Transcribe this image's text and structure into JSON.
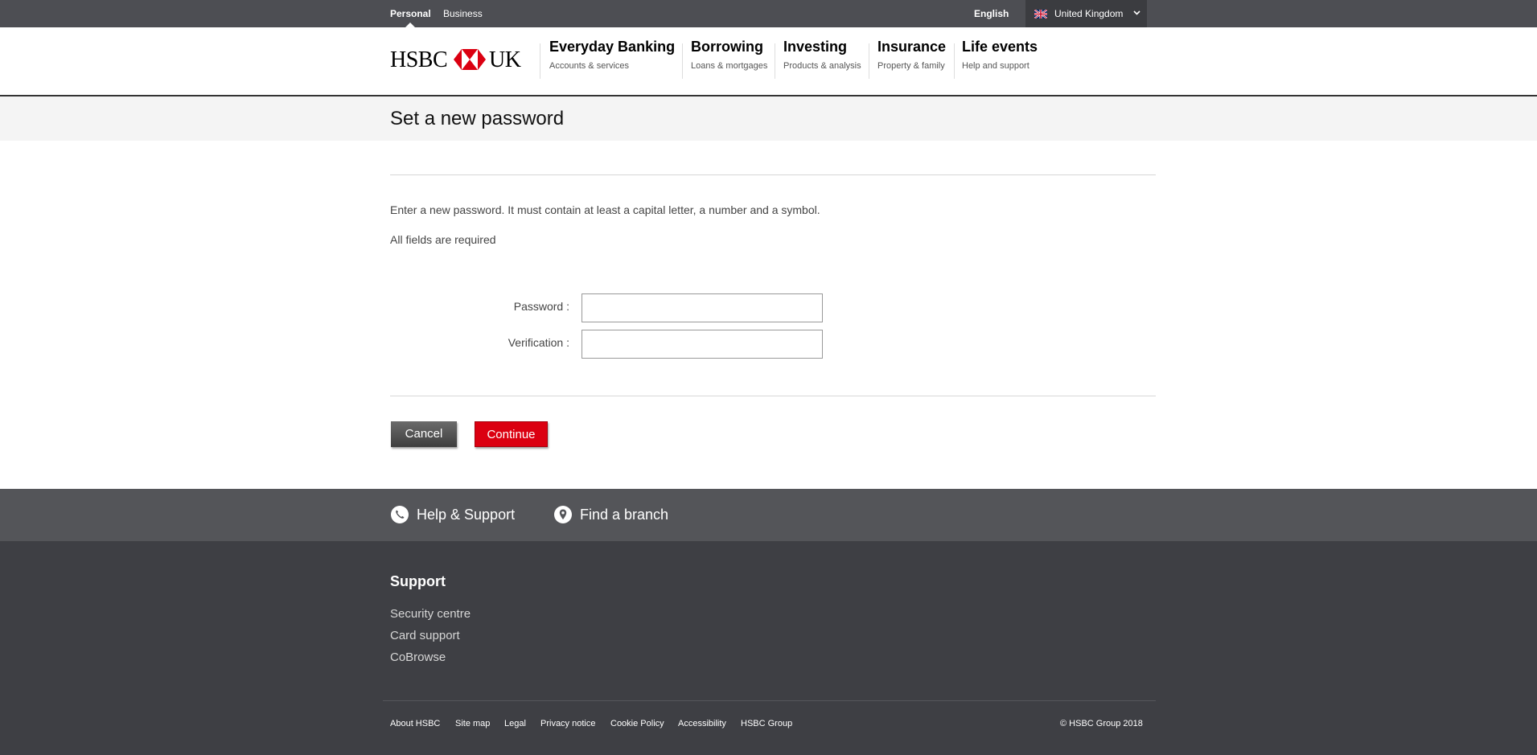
{
  "topbar": {
    "tabs": [
      {
        "label": "Personal",
        "active": true
      },
      {
        "label": "Business",
        "active": false
      }
    ],
    "language": "English",
    "region": {
      "label": "United Kingdom",
      "flag_icon": "uk-flag-icon"
    }
  },
  "header": {
    "logo": {
      "left_text": "HSBC",
      "right_text": "UK",
      "hexagon_color": "#db0011"
    },
    "nav": [
      {
        "title": "Everyday Banking",
        "subtitle": "Accounts & services"
      },
      {
        "title": "Borrowing",
        "subtitle": "Loans & mortgages"
      },
      {
        "title": "Investing",
        "subtitle": "Products & analysis"
      },
      {
        "title": "Insurance",
        "subtitle": "Property & family"
      },
      {
        "title": "Life events",
        "subtitle": "Help and support"
      }
    ]
  },
  "page": {
    "title": "Set a new password",
    "intro": "Enter a new password. It must contain at least a capital letter, a number and a symbol.",
    "required_note": "All fields are required",
    "fields": {
      "password": {
        "label": "Password :",
        "value": ""
      },
      "verification": {
        "label": "Verification :",
        "value": ""
      }
    },
    "buttons": {
      "cancel": "Cancel",
      "continue": "Continue"
    }
  },
  "help_band": {
    "help_support": {
      "label": "Help & Support",
      "icon": "phone-icon"
    },
    "find_branch": {
      "label": "Find a branch",
      "icon": "location-pin-icon"
    }
  },
  "footer": {
    "support_heading": "Support",
    "support_links": [
      "Security centre",
      "Card support",
      "CoBrowse"
    ],
    "bottom_links": [
      "About HSBC",
      "Site map",
      "Legal",
      "Privacy notice",
      "Cookie Policy",
      "Accessibility",
      "HSBC Group"
    ],
    "copyright": "© HSBC Group 2018"
  },
  "colors": {
    "brand_red": "#db0011",
    "topbar_bg": "#4d4e53",
    "footer_bg": "#3e3f44",
    "help_band_bg": "#545559"
  }
}
